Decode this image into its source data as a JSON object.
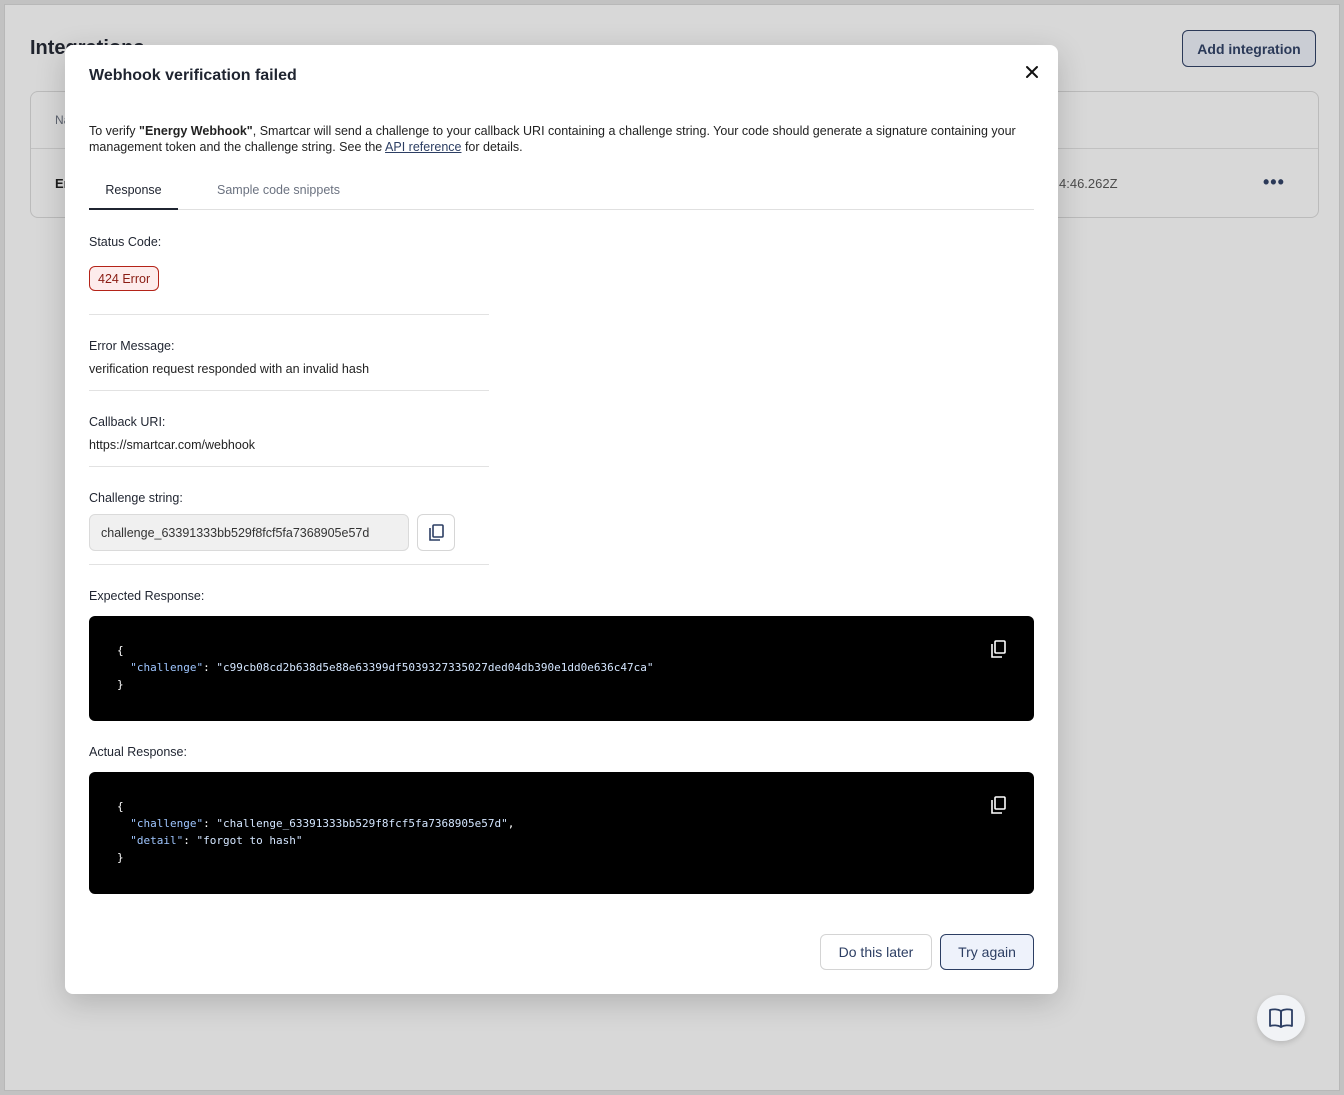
{
  "background": {
    "title": "Integrations",
    "add_button": "Add integration",
    "table": {
      "header_partial": "Na",
      "row_name_partial": "En",
      "row_date_partial": "4:46.262Z",
      "row_menu": "•••"
    }
  },
  "modal": {
    "title": "Webhook verification failed",
    "intro": {
      "prefix": "To verify ",
      "integration_name": "\"Energy Webhook\"",
      "middle": ", Smartcar will send a challenge to your callback URI containing a challenge string. Your code should generate a signature containing your management token and the challenge string. See the ",
      "link": "API reference",
      "suffix": " for details."
    },
    "tabs": [
      {
        "label": "Response",
        "active": true
      },
      {
        "label": "Sample code snippets",
        "active": false
      }
    ],
    "status_code": {
      "label": "Status Code:",
      "badge": "424 Error"
    },
    "error_message": {
      "label": "Error Message:",
      "value": "verification request responded with an invalid hash"
    },
    "callback_uri": {
      "label": "Callback URI:",
      "value": "https://smartcar.com/webhook"
    },
    "challenge_string": {
      "label": "Challenge string:",
      "value": "challenge_63391333bb529f8fcf5fa7368905e57d"
    },
    "expected_response": {
      "label": "Expected Response:",
      "open": "{",
      "lines": [
        {
          "key": "\"challenge\"",
          "value": "\"c99cb08cd2b638d5e88e63399df5039327335027ded04db390e1dd0e636c47ca\"",
          "comma": ""
        }
      ],
      "close": "}"
    },
    "actual_response": {
      "label": "Actual Response:",
      "open": "{",
      "lines": [
        {
          "key": "\"challenge\"",
          "value": "\"challenge_63391333bb529f8fcf5fa7368905e57d\"",
          "comma": ","
        },
        {
          "key": "\"detail\"",
          "value": "\"forgot to hash\"",
          "comma": ""
        }
      ],
      "close": "}"
    },
    "buttons": {
      "later": "Do this later",
      "try_again": "Try again"
    }
  },
  "colors": {
    "accent": "#2c3e63",
    "error_border": "#b42318",
    "error_bg": "#fdecec",
    "code_bg": "#000000"
  },
  "icons": {
    "close": "close-icon",
    "copy": "copy-icon",
    "help": "book-open-icon",
    "menu": "more-horizontal-icon"
  }
}
